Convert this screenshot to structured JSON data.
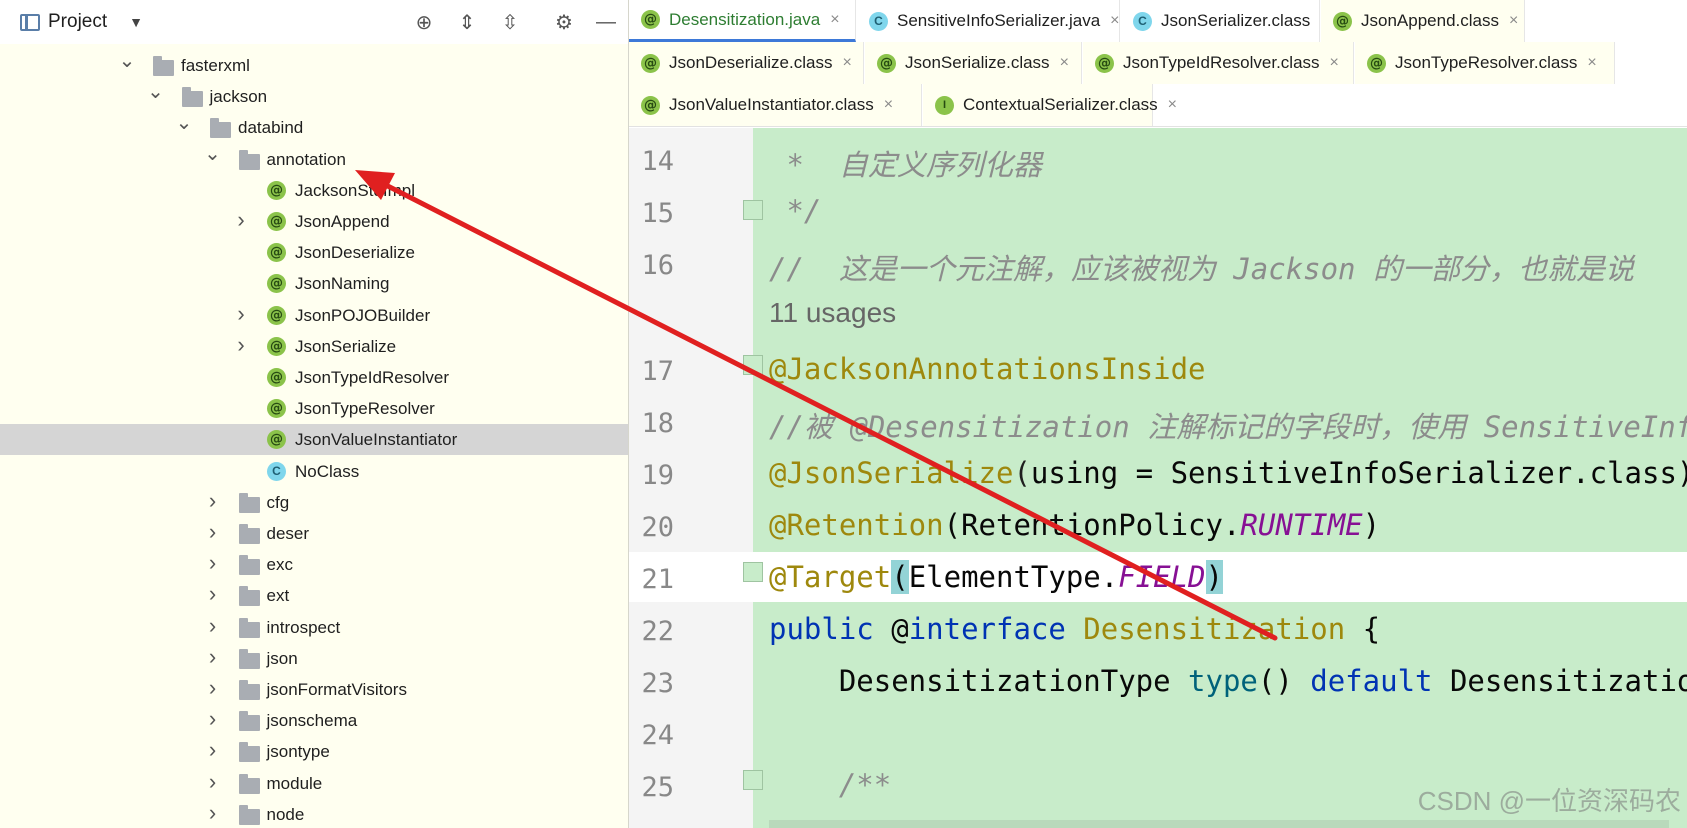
{
  "project_panel": {
    "title": "Project",
    "tree": [
      {
        "label": "fasterxml",
        "type": "folder",
        "depth": 1,
        "expanded": true
      },
      {
        "label": "jackson",
        "type": "folder",
        "depth": 2,
        "expanded": true
      },
      {
        "label": "databind",
        "type": "folder",
        "depth": 3,
        "expanded": true
      },
      {
        "label": "annotation",
        "type": "folder",
        "depth": 4,
        "expanded": true
      },
      {
        "label": "JacksonStdImpl",
        "type": "annotation",
        "depth": 5
      },
      {
        "label": "JsonAppend",
        "type": "annotation",
        "depth": 5,
        "expandable": true
      },
      {
        "label": "JsonDeserialize",
        "type": "annotation",
        "depth": 5
      },
      {
        "label": "JsonNaming",
        "type": "annotation",
        "depth": 5
      },
      {
        "label": "JsonPOJOBuilder",
        "type": "annotation",
        "depth": 5,
        "expandable": true
      },
      {
        "label": "JsonSerialize",
        "type": "annotation",
        "depth": 5,
        "expandable": true
      },
      {
        "label": "JsonTypeIdResolver",
        "type": "annotation",
        "depth": 5
      },
      {
        "label": "JsonTypeResolver",
        "type": "annotation",
        "depth": 5
      },
      {
        "label": "JsonValueInstantiator",
        "type": "annotation",
        "depth": 5,
        "selected": true
      },
      {
        "label": "NoClass",
        "type": "class",
        "depth": 5
      },
      {
        "label": "cfg",
        "type": "folder",
        "depth": 4
      },
      {
        "label": "deser",
        "type": "folder",
        "depth": 4
      },
      {
        "label": "exc",
        "type": "folder",
        "depth": 4
      },
      {
        "label": "ext",
        "type": "folder",
        "depth": 4
      },
      {
        "label": "introspect",
        "type": "folder",
        "depth": 4
      },
      {
        "label": "json",
        "type": "folder",
        "depth": 4
      },
      {
        "label": "jsonFormatVisitors",
        "type": "folder",
        "depth": 4
      },
      {
        "label": "jsonschema",
        "type": "folder",
        "depth": 4
      },
      {
        "label": "jsontype",
        "type": "folder",
        "depth": 4
      },
      {
        "label": "module",
        "type": "folder",
        "depth": 4
      },
      {
        "label": "node",
        "type": "folder",
        "depth": 4
      }
    ]
  },
  "tabs": [
    [
      {
        "label": "Desensitization.java",
        "icon": "annotation",
        "active": true
      },
      {
        "label": "SensitiveInfoSerializer.java",
        "icon": "class"
      },
      {
        "label": "JsonSerializer.class",
        "icon": "class"
      },
      {
        "label": "JsonAppend.class",
        "icon": "annotation"
      }
    ],
    [
      {
        "label": "JsonDeserialize.class",
        "icon": "annotation"
      },
      {
        "label": "JsonSerialize.class",
        "icon": "annotation"
      },
      {
        "label": "JsonTypeIdResolver.class",
        "icon": "annotation"
      },
      {
        "label": "JsonTypeResolver.class",
        "icon": "annotation"
      }
    ],
    [
      {
        "label": "JsonValueInstantiator.class",
        "icon": "annotation"
      },
      {
        "label": "ContextualSerializer.class",
        "icon": "interface"
      }
    ]
  ],
  "tab_close_glyph": "×",
  "editor": {
    "inlay_hint": "11 usages",
    "lines": [
      {
        "n": "14",
        "segments": [
          {
            "t": " *  自定义序列化器",
            "c": "#8c8c8c",
            "i": true
          }
        ]
      },
      {
        "n": "15",
        "segments": [
          {
            "t": " */",
            "c": "#8c8c8c",
            "i": true
          }
        ]
      },
      {
        "n": "16",
        "segments": [
          {
            "t": "//  这是一个元注解，应该被视为 Jackson 的一部分，也就是说",
            "c": "#8c8c8c",
            "i": true
          }
        ]
      },
      {
        "n": "17",
        "segments": [
          {
            "t": "@JacksonAnnotationsInside",
            "c": "#9e880d"
          }
        ]
      },
      {
        "n": "18",
        "segments": [
          {
            "t": "//被 @Desensitization 注解标记的字段时，使用 SensitiveInfo",
            "c": "#8c8c8c",
            "i": true
          }
        ]
      },
      {
        "n": "19",
        "segments": [
          {
            "t": "@JsonSerialize",
            "c": "#9e880d"
          },
          {
            "t": "(",
            "c": "#1f1f1f"
          },
          {
            "t": "using = SensitiveInfoSerializer.class)",
            "c": "#080808"
          }
        ]
      },
      {
        "n": "20",
        "segments": [
          {
            "t": "@Retention",
            "c": "#9e880d"
          },
          {
            "t": "(RetentionPolicy.",
            "c": "#080808"
          },
          {
            "t": "RUNTIME",
            "c": "#871094",
            "i": true
          },
          {
            "t": ")",
            "c": "#080808"
          }
        ]
      },
      {
        "n": "21",
        "segments": [
          {
            "t": "@Target",
            "c": "#9e880d"
          },
          {
            "t": "(",
            "c": "#080808",
            "h": true
          },
          {
            "t": "ElementType.",
            "c": "#080808"
          },
          {
            "t": "FIELD",
            "c": "#871094",
            "i": true
          },
          {
            "t": ")",
            "c": "#080808",
            "h": true
          }
        ]
      },
      {
        "n": "22",
        "segments": [
          {
            "t": "public ",
            "c": "#0033b3"
          },
          {
            "t": "@",
            "c": "#080808"
          },
          {
            "t": "interface ",
            "c": "#0033b3"
          },
          {
            "t": "Desensitization ",
            "c": "#9e880d"
          },
          {
            "t": "{",
            "c": "#080808"
          }
        ]
      },
      {
        "n": "23",
        "segments": [
          {
            "t": "    DesensitizationType ",
            "c": "#080808"
          },
          {
            "t": "type",
            "c": "#00627a"
          },
          {
            "t": "() ",
            "c": "#080808"
          },
          {
            "t": "default ",
            "c": "#0033b3"
          },
          {
            "t": "DesensitizationType.NONE;",
            "c": "#080808"
          }
        ]
      },
      {
        "n": "24",
        "segments": []
      },
      {
        "n": "25",
        "segments": [
          {
            "t": "    /**",
            "c": "#8c8c8c",
            "i": true
          }
        ]
      }
    ]
  },
  "watermark": "CSDN @一位资深码农"
}
